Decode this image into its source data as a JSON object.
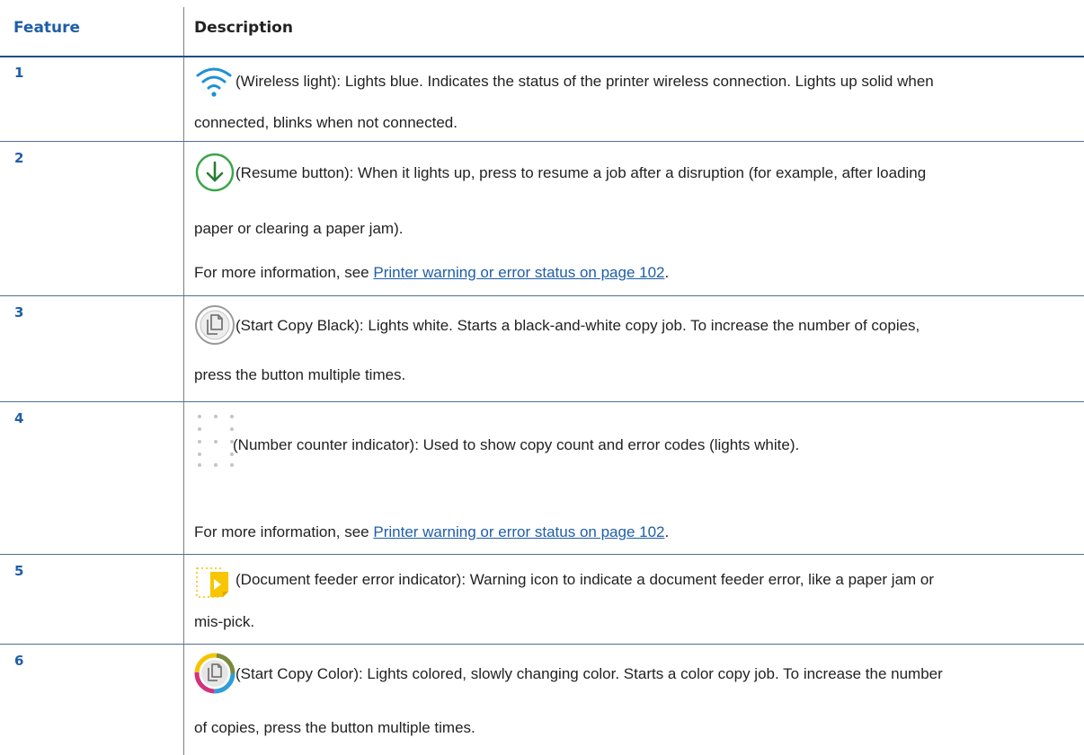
{
  "header": {
    "feature": "Feature",
    "description": "Description"
  },
  "rows": [
    {
      "num": "1",
      "icon": "wifi-icon",
      "line1": "(Wireless light): Lights blue. Indicates the status of the printer wireless connection. Lights up solid when",
      "line2": "connected, blinks when not connected."
    },
    {
      "num": "2",
      "icon": "resume-icon",
      "line1": "(Resume button): When it lights up, press to resume a job after a disruption (for example, after loading",
      "line2": "paper or clearing a paper jam).",
      "more_prefix": "For more information, see ",
      "more_link": "Printer warning or error status on page 102",
      "more_suffix": "."
    },
    {
      "num": "3",
      "icon": "copy-black-icon",
      "line1": "(Start Copy Black): Lights white. Starts a black-and-white copy job. To increase the number of copies,",
      "line2": "press the button multiple times."
    },
    {
      "num": "4",
      "icon": "number-counter-icon",
      "line1": "(Number counter indicator): Used to show copy count and error codes (lights white).",
      "more_prefix": "For more information, see ",
      "more_link": "Printer warning or error status on page 102",
      "more_suffix": "."
    },
    {
      "num": "5",
      "icon": "document-feeder-error-icon",
      "line1": "(Document feeder error indicator): Warning icon to indicate a document feeder error, like a paper jam or",
      "line2": "mis-pick."
    },
    {
      "num": "6",
      "icon": "copy-color-icon",
      "line1": "(Start Copy Color): Lights colored, slowly changing color. Starts a color copy job. To increase the number",
      "line2": "of copies, press the button multiple times."
    }
  ],
  "colors": {
    "accent": "#1f5ea8",
    "resume_green": "#3aa54a",
    "feeder_yellow": "#f2c200"
  }
}
